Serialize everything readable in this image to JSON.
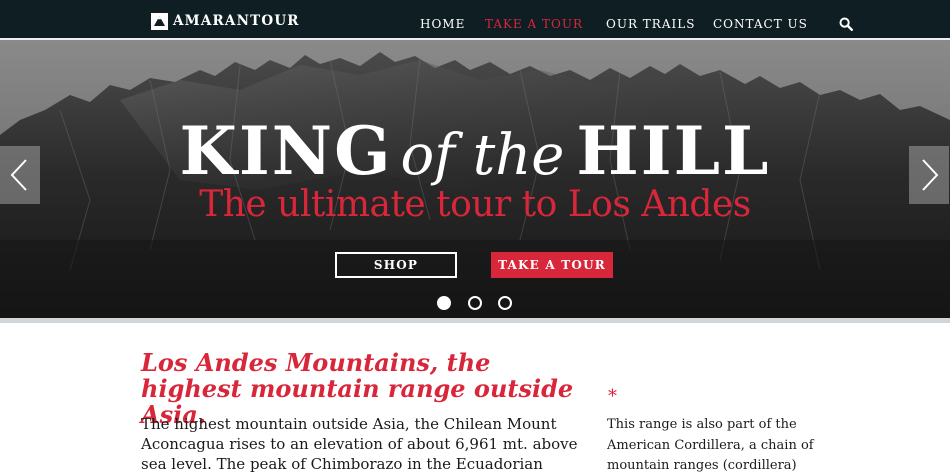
{
  "nav": {
    "logo_text": "AMARANTOUR",
    "items": [
      {
        "label": "HOME",
        "active": false
      },
      {
        "label": "TAKE A TOUR",
        "active": true
      },
      {
        "label": "OUR TRAILS",
        "active": false
      },
      {
        "label": "CONTACT US",
        "active": false
      }
    ],
    "search_icon": "search-icon"
  },
  "hero": {
    "title_part1": "KING",
    "title_part2": "of the",
    "title_part3": "HILL",
    "subtitle": "The ultimate tour to Los Andes",
    "shop_label": "SHOP",
    "tour_label": "TAKE A TOUR",
    "slides_count": 3,
    "active_slide": 1,
    "prev_icon": "chevron-left-icon",
    "next_icon": "chevron-right-icon"
  },
  "content": {
    "heading": "Los Andes Mountains, the highest mountain range outside Asia.",
    "body": "The highest mountain outside Asia, the Chilean Mount Aconcagua rises to an elevation of about 6,961 mt. above sea level. The peak of Chimborazo in the Ecuadorian",
    "aside_mark": "*",
    "aside_text": "This range is also part of the American Cordillera, a chain of mountain ranges (cordillera)"
  },
  "colors": {
    "accent": "#d8263a",
    "nav_bg": "#0e1e22",
    "text": "#1a1a1a"
  }
}
